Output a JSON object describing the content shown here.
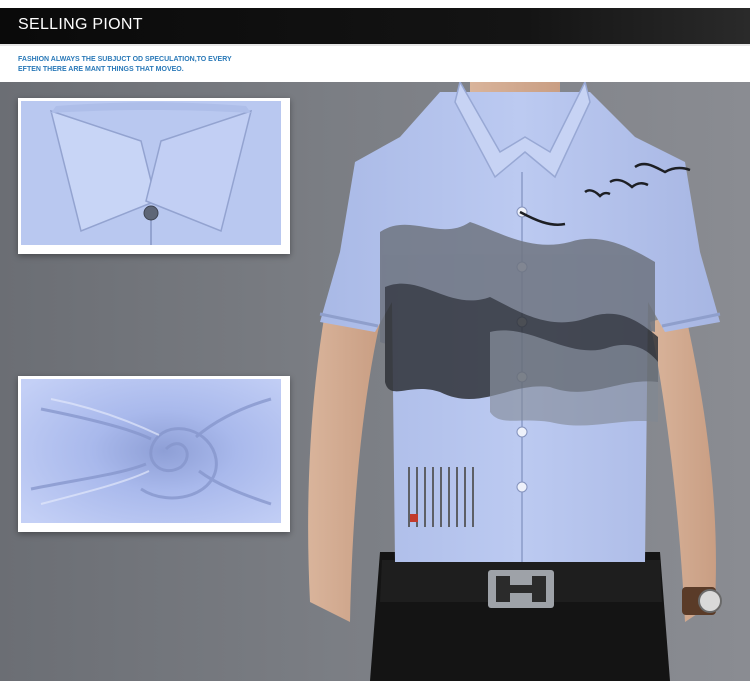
{
  "header": {
    "title": "SELLING PIONT"
  },
  "tagline": {
    "line1": "FASHION ALWAYS THE  SUBJUCT OD SPECULATION,TO EVERY",
    "line2": "EFTEN THERE ARE MANT THINGS THAT MOVEO."
  },
  "colors": {
    "title_bar": "#0d0d0d",
    "tagline_text": "#2a79b8",
    "shirt": "#b7c6ef",
    "background": "#767980"
  }
}
